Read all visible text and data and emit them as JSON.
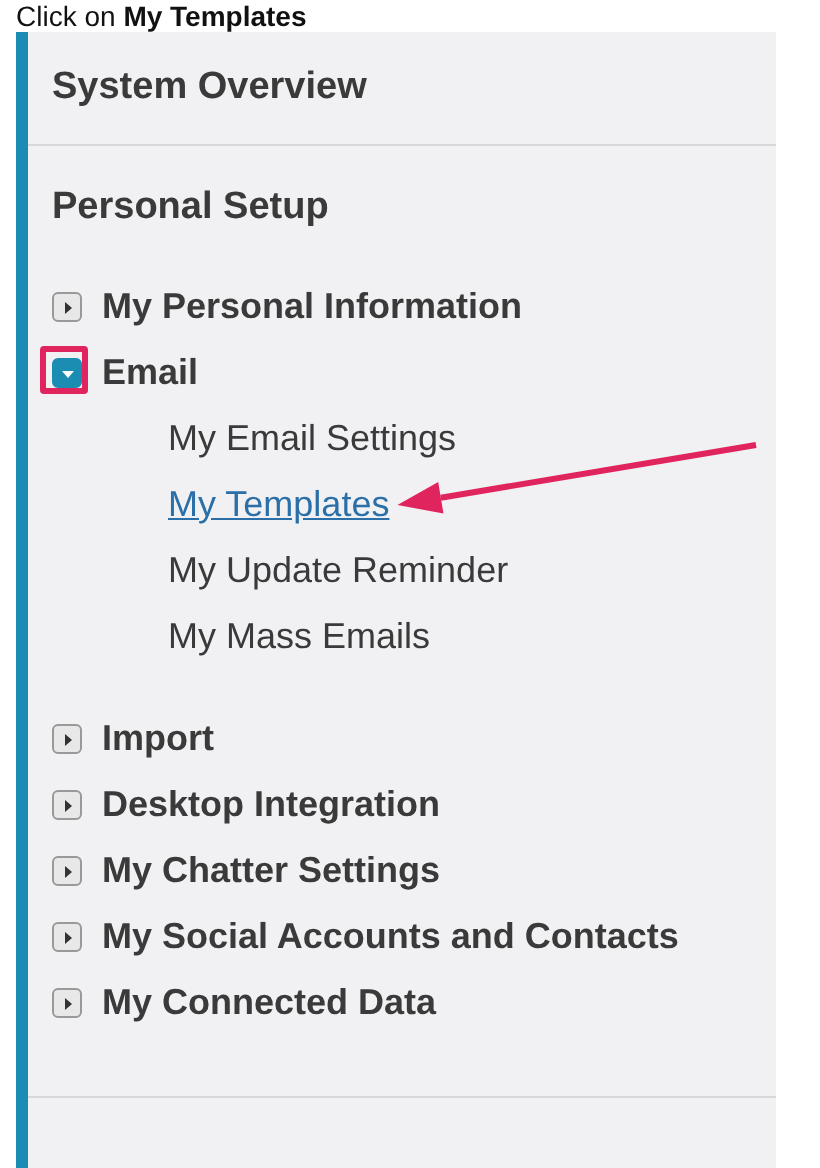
{
  "caption": "Click on **My Templates**",
  "sections": [
    {
      "title": "System Overview"
    },
    {
      "title": "Personal Setup",
      "groups": [
        {
          "items": [
            {
              "label": "My Personal Information",
              "expanded": false,
              "marked": false
            },
            {
              "label": "Email",
              "expanded": true,
              "marked": true,
              "children": [
                {
                  "label": "My Email Settings",
                  "selected": false,
                  "pointed": false
                },
                {
                  "label": "My Templates",
                  "selected": true,
                  "pointed": true
                },
                {
                  "label": "My Update Reminder",
                  "selected": false,
                  "pointed": false
                },
                {
                  "label": "My Mass Emails",
                  "selected": false,
                  "pointed": false
                }
              ]
            }
          ]
        },
        {
          "items": [
            {
              "label": "Import",
              "expanded": false,
              "marked": false
            },
            {
              "label": "Desktop Integration",
              "expanded": false,
              "marked": false
            },
            {
              "label": "My Chatter Settings",
              "expanded": false,
              "marked": false
            },
            {
              "label": "My Social Accounts and Contacts",
              "expanded": false,
              "marked": false
            },
            {
              "label": "My Connected Data",
              "expanded": false,
              "marked": false
            }
          ]
        }
      ]
    }
  ]
}
